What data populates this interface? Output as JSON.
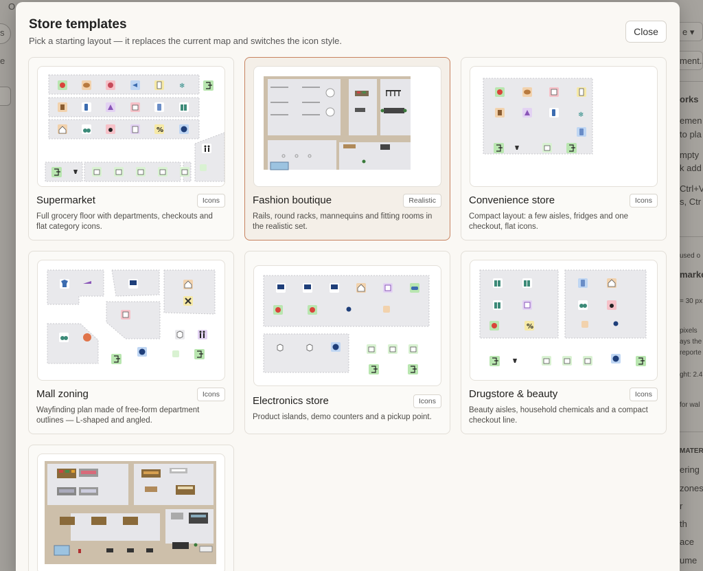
{
  "modal": {
    "title": "Store templates",
    "subtitle": "Pick a starting layout — it replaces the current map and switches the icon style.",
    "close_label": "Close"
  },
  "cards": [
    {
      "title": "Supermarket",
      "badge": "Icons",
      "description": "Full grocery floor with departments, checkouts and flat category icons."
    },
    {
      "title": "Fashion boutique",
      "badge": "Realistic",
      "description": "Rails, round racks, mannequins and fitting rooms in the realistic set."
    },
    {
      "title": "Convenience store",
      "badge": "Icons",
      "description": "Compact layout: a few aisles, fridges and one checkout, flat icons."
    },
    {
      "title": "Mall zoning",
      "badge": "Icons",
      "description": "Wayfinding plan made of free-form department outlines — L-shaped and angled."
    },
    {
      "title": "Electronics store",
      "badge": "Icons",
      "description": "Product islands, demo counters and a pickup point."
    },
    {
      "title": "Drugstore & beauty",
      "badge": "Icons",
      "description": "Beauty aisles, household chemicals and a compact checkout line."
    },
    {
      "title": "",
      "badge": "",
      "description": ""
    }
  ],
  "background": {
    "right_panel": [
      "e ▾",
      "ment...",
      "orks",
      "emen",
      "to pla",
      "mpty",
      "k add",
      "Ctrl+V",
      "s, Ctr",
      "used o",
      "market",
      "= 30 px",
      "pixels",
      "ays the",
      "reporte",
      "ght: 2.4",
      "for wal",
      "MATER",
      "ering",
      "zones",
      "r",
      "th",
      "ace",
      "ume"
    ],
    "left_panel": [
      "O",
      "s",
      "e"
    ]
  }
}
